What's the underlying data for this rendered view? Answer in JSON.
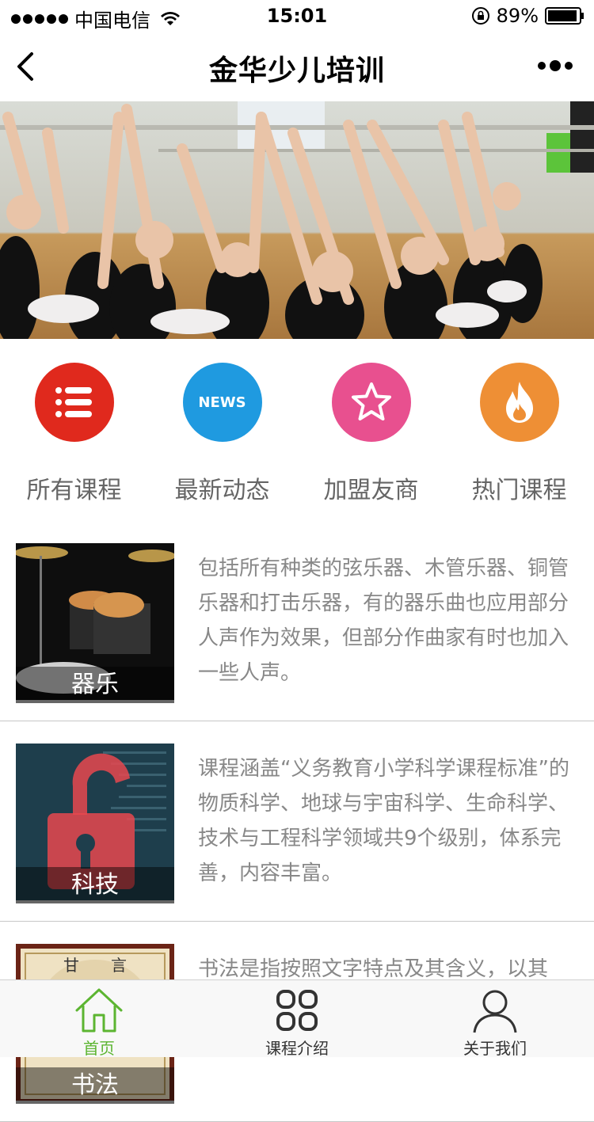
{
  "status_bar": {
    "carrier": "中国电信",
    "time": "15:01",
    "battery": "89%"
  },
  "nav": {
    "title": "金华少儿培训"
  },
  "menu": [
    {
      "label": "所有课程",
      "icon": "list-icon",
      "color": "#e0291d"
    },
    {
      "label": "最新动态",
      "icon": "news-icon",
      "icon_text": "NEWS",
      "color": "#1f9ae0"
    },
    {
      "label": "加盟友商",
      "icon": "star-icon",
      "color": "#e8508f"
    },
    {
      "label": "热门课程",
      "icon": "fire-icon",
      "color": "#ee8f35"
    }
  ],
  "courses": [
    {
      "caption": "器乐",
      "description": "包括所有种类的弦乐器、木管乐器、铜管乐器和打击乐器，有的器乐曲也应用部分人声作为效果，但部分作曲家有时也加入一些人声。"
    },
    {
      "caption": "科技",
      "description": "课程涵盖“义务教育小学科学课程标准”的物质科学、地球与宇宙科学、生命科学、技术与工程科学领域共9个级别，体系完善，内容丰富。"
    },
    {
      "caption": "书法",
      "description": "书法是指按照文字特点及其含义，以其"
    }
  ],
  "tab_bar": {
    "tabs": [
      {
        "label": "首页",
        "icon": "home-icon",
        "active": true
      },
      {
        "label": "课程介绍",
        "icon": "grid-icon",
        "active": false
      },
      {
        "label": "关于我们",
        "icon": "user-icon",
        "active": false
      }
    ],
    "active_color": "#5cb531"
  }
}
